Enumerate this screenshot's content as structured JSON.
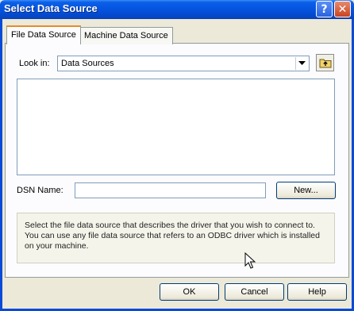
{
  "window": {
    "title": "Select Data Source",
    "help_glyph": "?",
    "close_glyph": "✕"
  },
  "tabs": [
    {
      "label": "File Data Source",
      "active": true
    },
    {
      "label": "Machine Data Source",
      "active": false
    }
  ],
  "look_in": {
    "label": "Look in:",
    "value": "Data Sources",
    "icon": "chevron-down-icon",
    "up_button_icon": "up-folder-icon"
  },
  "file_list": {
    "items": []
  },
  "dsn": {
    "label": "DSN Name:",
    "value": "",
    "new_button": "New..."
  },
  "info_text": "Select the file data source that describes the driver that you wish to connect to. You can use any file data source that refers to an ODBC driver which is installed on your machine.",
  "buttons": {
    "ok": "OK",
    "cancel": "Cancel",
    "help": "Help"
  },
  "colors": {
    "titlebar": "#0553de",
    "dialog_bg": "#ece9d8",
    "tab_highlight": "#e68b2c"
  }
}
